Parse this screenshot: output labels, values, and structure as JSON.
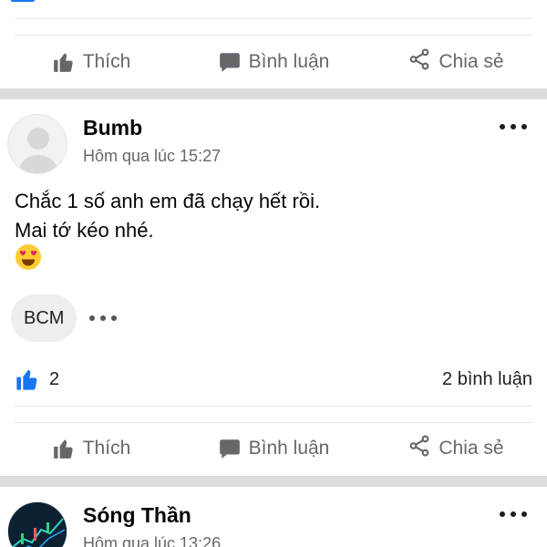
{
  "actions": {
    "like": "Thích",
    "comment": "Bình luận",
    "share": "Chia sẻ"
  },
  "post1": {
    "author": "Bumb",
    "time": "Hôm qua lúc 15:27",
    "text_line1": "Chắc 1 số anh em đã chạy hết rồi.",
    "text_line2": "Mai tớ kéo nhé.",
    "emoji": "heart-eyes-emoji",
    "tag": "BCM",
    "likes": "2",
    "comments": "2 bình luận"
  },
  "post2": {
    "author": "Sóng Thần",
    "time": "Hôm qua lúc 13:26"
  },
  "colors": {
    "accent": "#1877f2",
    "divider": "#dcdcdc",
    "muted_text": "#65676b"
  }
}
